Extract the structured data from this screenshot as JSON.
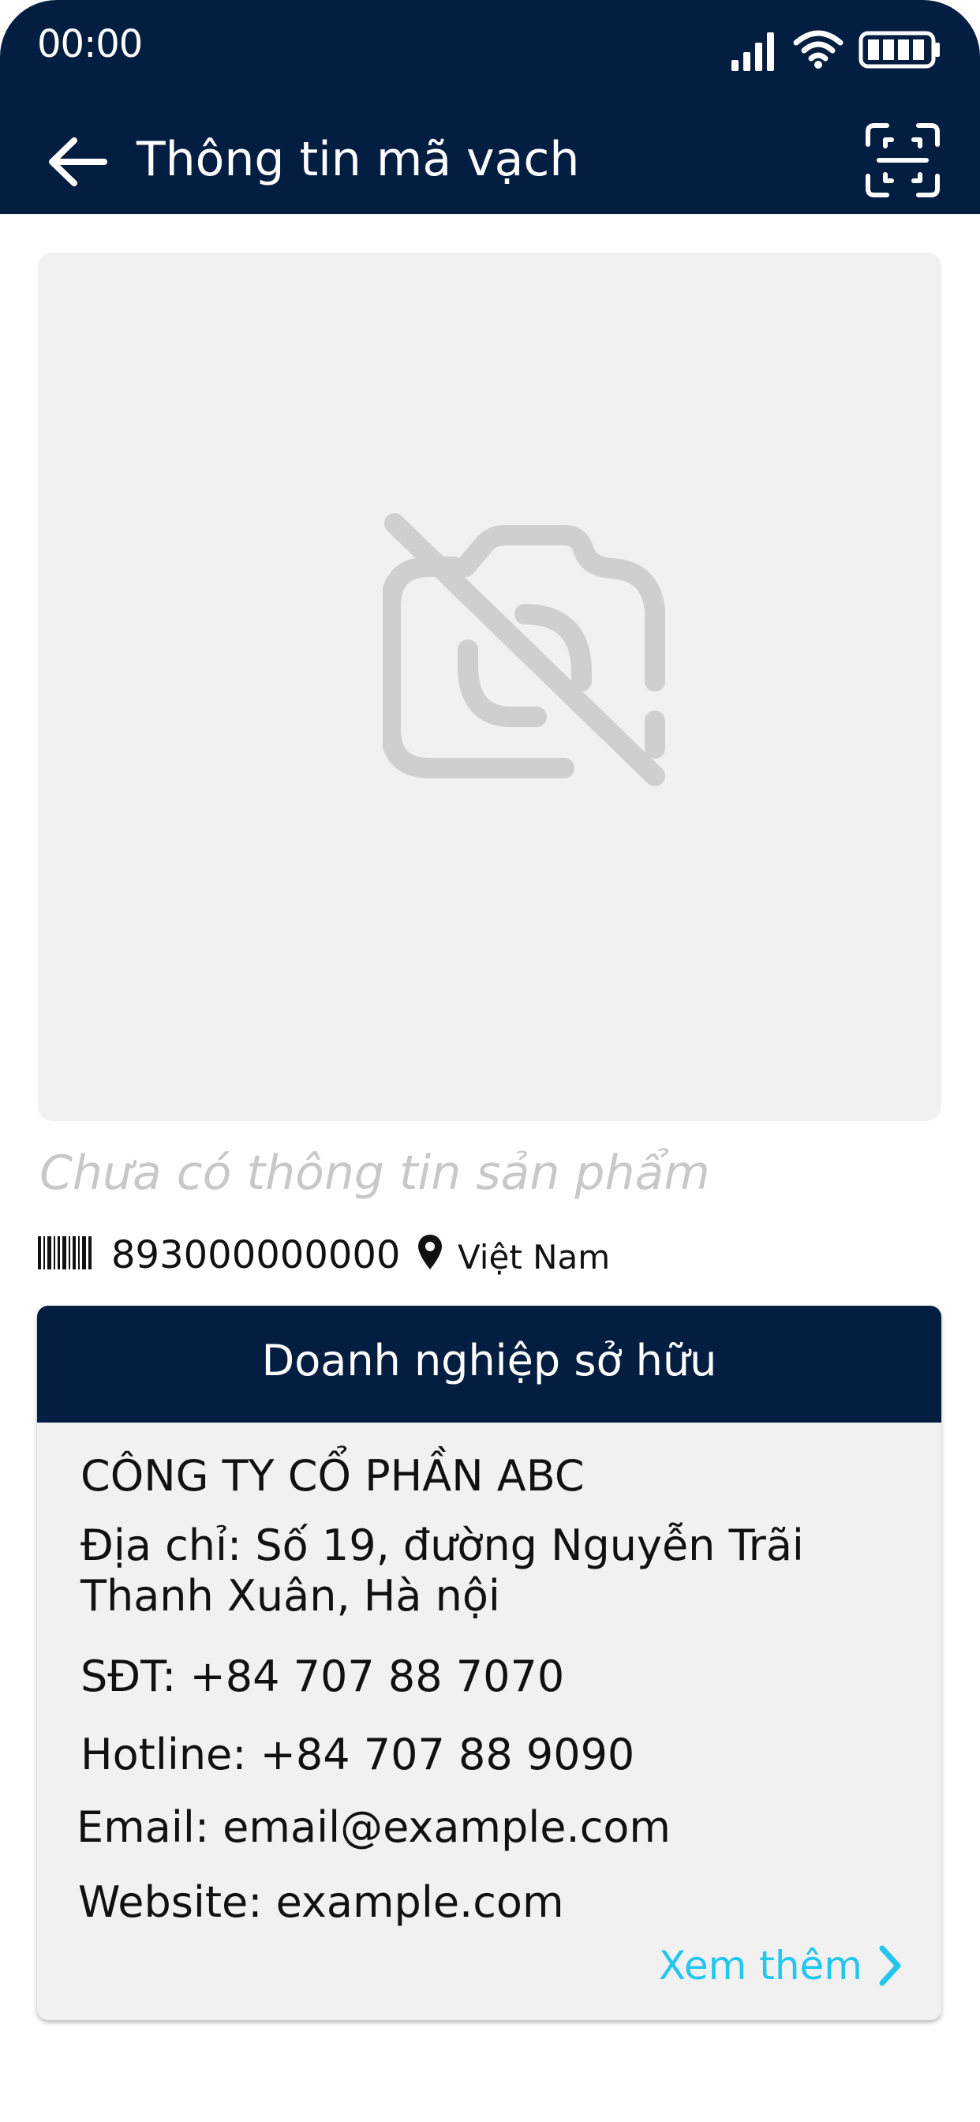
{
  "status_bar": {
    "time": "00:00",
    "icons": [
      "signal-icon",
      "wifi-icon",
      "battery-icon"
    ]
  },
  "header": {
    "title": "Thông tin mã vạch",
    "back_icon": "arrow-left-icon",
    "scan_icon": "scan-frame-icon"
  },
  "product": {
    "image_icon": "no-camera-icon",
    "name_placeholder": "Chưa có thông tin sản phẩm",
    "barcode": "893000000000",
    "country": "Việt Nam"
  },
  "owner": {
    "section_title": "Doanh nghiệp sở hữu",
    "company_name": "CÔNG TY CỔ PHẦN ABC",
    "address_line1": "Địa chỉ: Số 19, đường Nguyễn Trãi",
    "address_line2": "Thanh Xuân, Hà nội",
    "phone": "SĐT: +84 707 88 7070",
    "hotline": "Hotline: +84 707 88 9090",
    "email": "Email: email@example.com",
    "website": "Website: example.com",
    "see_more": "Xem thêm"
  },
  "colors": {
    "navy": "#041e42",
    "accent": "#22c6ef",
    "card_bg": "#f1f1f1",
    "placeholder_text": "#c8c8c8"
  }
}
